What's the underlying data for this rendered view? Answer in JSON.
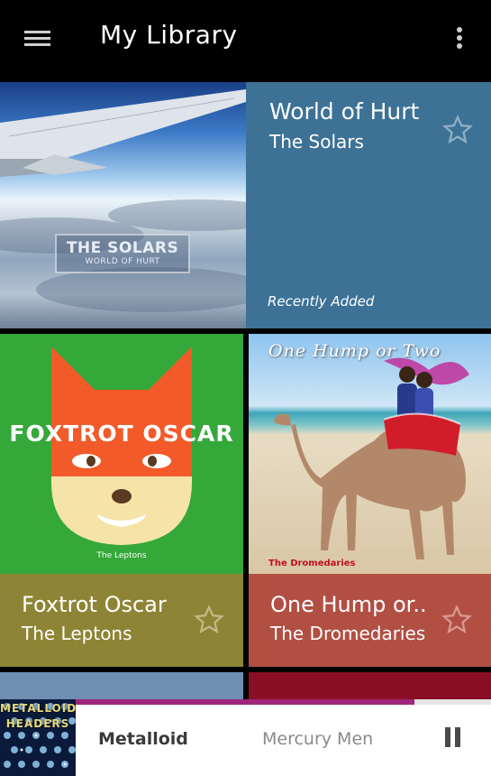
{
  "app": {
    "title": "My Library"
  },
  "featured": {
    "cover_band": "THE SOLARS",
    "cover_album": "WORLD OF HURT",
    "album": "World of Hurt",
    "artist": "The Solars",
    "tag": "Recently Added",
    "info_bg": "#3d7296"
  },
  "tiles": [
    {
      "cover_title": "FOXTROT OSCAR",
      "cover_credit": "The Leptons",
      "album": "Foxtrot Oscar",
      "artist": "The Leptons",
      "art_bg": "#35a83a",
      "info_bg": "#8e8435"
    },
    {
      "cover_title": "One Hump or Two",
      "cover_credit": "The Dromedaries",
      "album": "One Hump or..",
      "artist": "The Dromedaries",
      "info_bg": "#b24f43"
    }
  ],
  "now_playing": {
    "cover_text": "METALLOID HEADERS",
    "title": "Metalloid",
    "artist": "Mercury Men",
    "progress": 0.815,
    "progress_color": "#a0257a"
  },
  "icons": [
    "menu-icon",
    "more-vert-icon",
    "star-outline-icon",
    "pause-icon"
  ]
}
